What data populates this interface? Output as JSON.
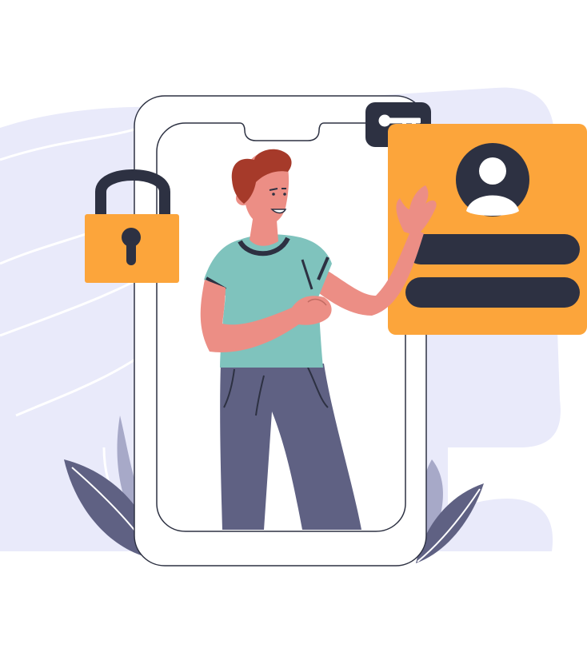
{
  "illustration": {
    "colors": {
      "background_blob": "#E9EAFA",
      "blob_line": "#FFFFFF",
      "phone_outline": "#2D3142",
      "lock_body": "#FCA53B",
      "lock_shackle": "#2D3142",
      "key_badge": "#2D3142",
      "key": "#FFFFFF",
      "profile_card": "#FCA53B",
      "profile_bar": "#2D3142",
      "avatar_bg": "#2D3142",
      "avatar_figure": "#FFFFFF",
      "shirt": "#7FC3BD",
      "pants": "#5F6183",
      "skin": "#EC8E85",
      "hair": "#A63A2A",
      "leaf": "#5F6183",
      "leaf_light": "#A7A9C8"
    },
    "icons": {
      "lock": "padlock-icon",
      "key": "key-icon",
      "avatar": "user-avatar-icon"
    }
  }
}
